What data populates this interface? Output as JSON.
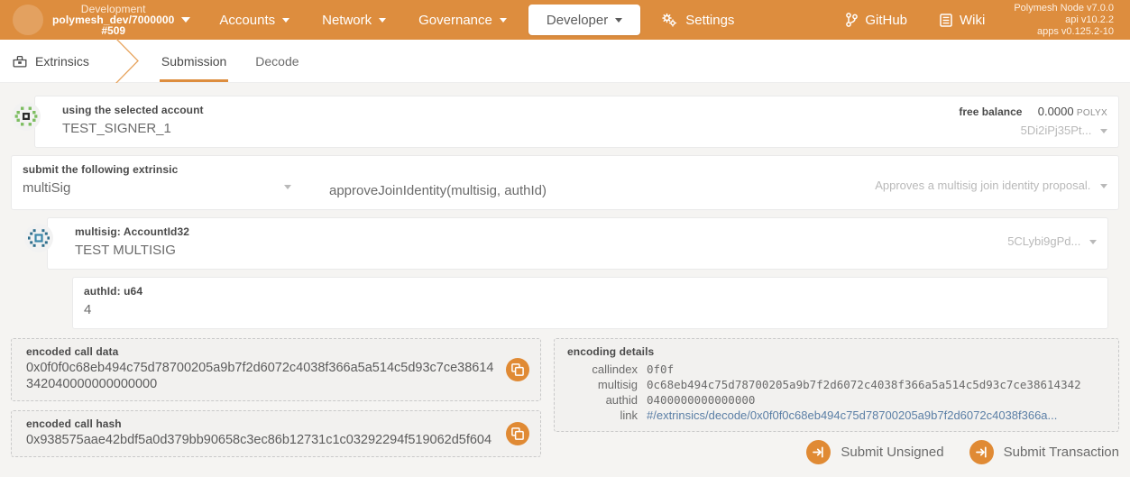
{
  "topbar": {
    "chain": {
      "name": "Development",
      "spec": "polymesh_dev/7000000",
      "block": "#509"
    },
    "nav": [
      {
        "label": "Accounts",
        "icon": "chevron-down-icon",
        "active": false
      },
      {
        "label": "Network",
        "icon": "chevron-down-icon",
        "active": false
      },
      {
        "label": "Governance",
        "icon": "chevron-down-icon",
        "active": false
      },
      {
        "label": "Developer",
        "icon": "chevron-down-icon",
        "active": true
      },
      {
        "label": "Settings",
        "icon": "gear-icon",
        "active": false
      }
    ],
    "links": [
      {
        "label": "GitHub",
        "icon": "git-branch-icon"
      },
      {
        "label": "Wiki",
        "icon": "book-icon"
      }
    ],
    "version": {
      "node": "Polymesh Node v7.0.0",
      "api": "api v10.2.2",
      "apps": "apps v0.125.2-10"
    }
  },
  "tabbar": {
    "section": "Extrinsics",
    "section_icon": "extrinsics-icon",
    "tabs": [
      {
        "label": "Submission",
        "active": true
      },
      {
        "label": "Decode",
        "active": false
      }
    ]
  },
  "account_row": {
    "label": "using the selected account",
    "value": "TEST_SIGNER_1",
    "identicon": "signer-identicon",
    "balance_label": "free balance",
    "balance_amount": "0.0000",
    "balance_unit": "POLYX",
    "address": "5Di2iPj35Pt..."
  },
  "extrinsic_row": {
    "label": "submit the following extrinsic",
    "pallet": "multiSig",
    "method": "approveJoinIdentity(multisig, authId)",
    "description": "Approves a multisig join identity proposal."
  },
  "multisig_row": {
    "label": "multisig: AccountId32",
    "value": "TEST MULTISIG",
    "identicon": "multisig-identicon",
    "address": "5CLybi9gPd..."
  },
  "authid_row": {
    "label": "authId: u64",
    "value": "4"
  },
  "encoded": {
    "call_data_label": "encoded call data",
    "call_data_value": "0x0f0f0c68eb494c75d78700205a9b7f2d6072c4038f366a5a514c5d93c7ce38614342040000000000000",
    "call_hash_label": "encoded call hash",
    "call_hash_value": "0x938575aae42bdf5a0d379bb90658c3ec86b12731c1c03292294f519062d5f604",
    "copy_icon": "copy-icon"
  },
  "encoding_details": {
    "title": "encoding details",
    "rows": [
      {
        "key": "callindex",
        "value": "0f0f",
        "is_link": false
      },
      {
        "key": "multisig",
        "value": "0c68eb494c75d78700205a9b7f2d6072c4038f366a5a514c5d93c7ce38614342",
        "is_link": false
      },
      {
        "key": "authid",
        "value": "0400000000000000",
        "is_link": false
      },
      {
        "key": "link",
        "value": "#/extrinsics/decode/0x0f0f0c68eb494c75d78700205a9b7f2d6072c4038f366a...",
        "is_link": true
      }
    ]
  },
  "footer": {
    "submit_unsigned": "Submit Unsigned",
    "submit_transaction": "Submit Transaction",
    "icon": "sign-in-icon"
  },
  "colors": {
    "brand": "#dd8d3e",
    "accent": "#e08a34",
    "page_bg": "#f5f4f2",
    "link": "#5b7fa6"
  }
}
